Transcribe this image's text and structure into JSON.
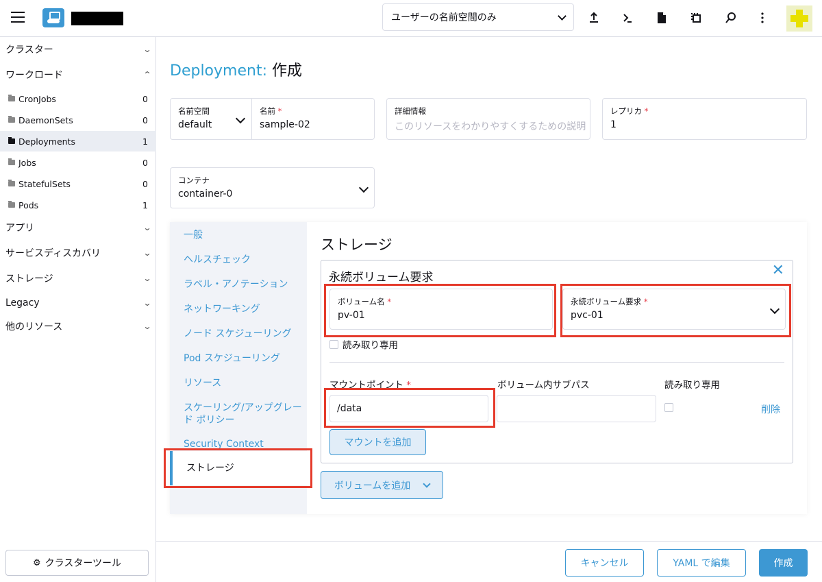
{
  "header": {
    "namespace_filter": "ユーザーの名前空間のみ",
    "icons": [
      "menu-icon",
      "upload-icon",
      "terminal-icon",
      "document-icon",
      "copy-icon",
      "search-icon",
      "more-vertical-icon",
      "user-avatar"
    ]
  },
  "sidebar": {
    "groups": [
      {
        "label": "クラスター",
        "expanded": false
      },
      {
        "label": "ワークロード",
        "expanded": true
      },
      {
        "label": "アプリ",
        "expanded": false
      },
      {
        "label": "サービスディスカバリ",
        "expanded": false
      },
      {
        "label": "ストレージ",
        "expanded": false
      },
      {
        "label": "Legacy",
        "expanded": false
      },
      {
        "label": "他のリソース",
        "expanded": false
      }
    ],
    "workload_items": [
      {
        "label": "CronJobs",
        "count": "0"
      },
      {
        "label": "DaemonSets",
        "count": "0"
      },
      {
        "label": "Deployments",
        "count": "1",
        "active": true
      },
      {
        "label": "Jobs",
        "count": "0"
      },
      {
        "label": "StatefulSets",
        "count": "0"
      },
      {
        "label": "Pods",
        "count": "1"
      }
    ],
    "cluster_tools": "クラスターツール"
  },
  "page": {
    "kind": "Deployment:",
    "action": "作成"
  },
  "form": {
    "namespace_label": "名前空間",
    "namespace_value": "default",
    "name_label": "名前",
    "name_value": "sample-02",
    "description_label": "詳細情報",
    "description_placeholder": "このリソースをわかりやすくするための説明",
    "replicas_label": "レプリカ",
    "replicas_value": "1",
    "container_label": "コンテナ",
    "container_value": "container-0"
  },
  "tabs": [
    "一般",
    "ヘルスチェック",
    "ラベル・アノテーション",
    "ネットワーキング",
    "ノード スケジューリング",
    "Pod スケジューリング",
    "リソース",
    "スケーリング/アップグレード ポリシー",
    "Security Context",
    "ストレージ"
  ],
  "storage": {
    "title": "ストレージ",
    "pvc_box_title": "永続ボリューム要求",
    "volume_name_label": "ボリューム名",
    "volume_name_value": "pv-01",
    "pvc_label": "永続ボリューム要求",
    "pvc_value": "pvc-01",
    "readonly_label": "読み取り専用",
    "mount_point_header": "マウントポイント",
    "subpath_header": "ボリューム内サブパス",
    "readonly_header": "読み取り専用",
    "mount_point_value": "/data",
    "subpath_value": "",
    "delete_label": "削除",
    "add_mount_label": "マウントを追加",
    "add_volume_label": "ボリュームを追加"
  },
  "footer": {
    "cancel_label": "キャンセル",
    "yaml_label": "YAML で編集",
    "create_label": "作成"
  }
}
